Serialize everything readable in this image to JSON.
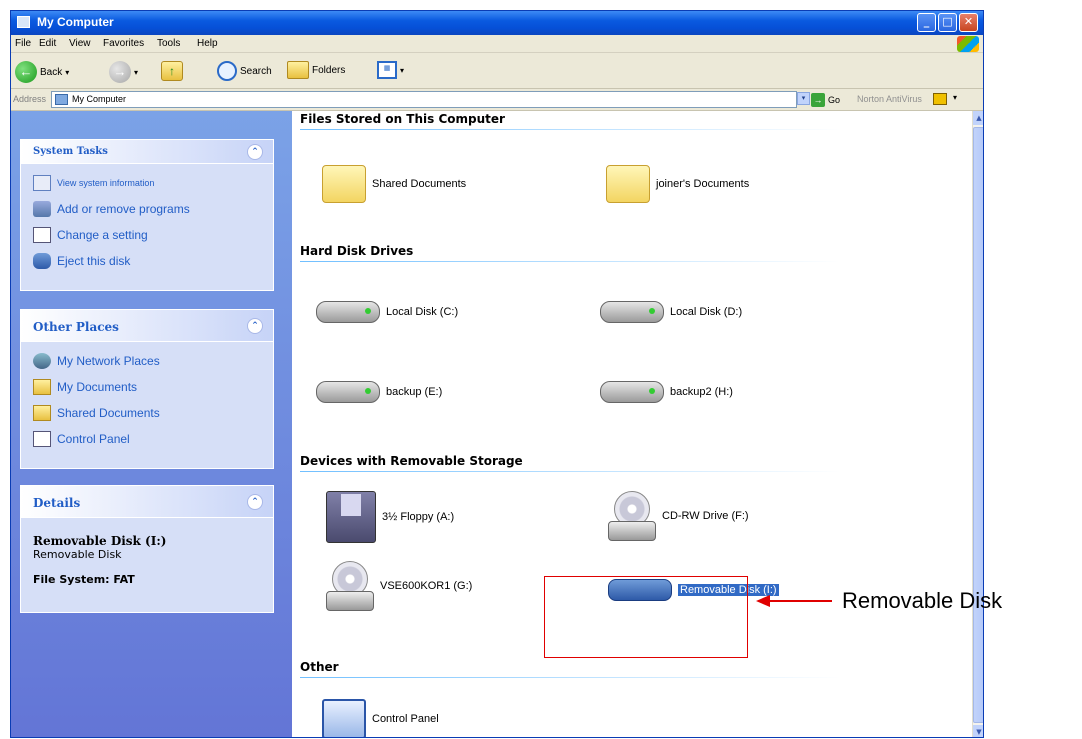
{
  "window": {
    "title": "My Computer",
    "controls": {
      "minimize": "_",
      "maximize": "□",
      "close": "✕"
    }
  },
  "menubar": [
    "File",
    "Edit",
    "View",
    "Favorites",
    "Tools",
    "Help"
  ],
  "toolbar": {
    "back_label": "Back",
    "search_label": "Search",
    "folders_label": "Folders"
  },
  "addressbar": {
    "label": "Address",
    "value": "My Computer",
    "go_label": "Go",
    "norton_label": "Norton AntiVirus"
  },
  "taskpane": {
    "system_tasks": {
      "title": "System Tasks",
      "items": [
        "View system information",
        "Add or remove programs",
        "Change a setting",
        "Eject this disk"
      ]
    },
    "other_places": {
      "title": "Other Places",
      "items": [
        "My Network Places",
        "My Documents",
        "Shared Documents",
        "Control Panel"
      ]
    },
    "details": {
      "title": "Details",
      "name": "Removable Disk (I:)",
      "type": "Removable Disk",
      "file_system": "File System: FAT"
    }
  },
  "groups": {
    "stored": {
      "title": "Files Stored on This Computer",
      "items": [
        "Shared Documents",
        "joiner's Documents"
      ]
    },
    "hard_disks": {
      "title": "Hard Disk Drives",
      "items": [
        "Local Disk (C:)",
        "Local Disk (D:)",
        "backup (E:)",
        "backup2 (H:)"
      ]
    },
    "removable": {
      "title": "Devices with Removable Storage",
      "items": [
        "3½ Floppy (A:)",
        "CD-RW Drive (F:)",
        "VSE600KOR1 (G:)",
        "Removable Disk (I:)"
      ]
    },
    "other": {
      "title": "Other",
      "items": [
        "Control Panel"
      ]
    }
  },
  "annotation": {
    "callout_text": "Removable Disk",
    "color": "#e00000"
  },
  "colors": {
    "title_bar": "#0a5ae0",
    "task_pane": "#6f8fe0",
    "panel_title": "#215dc6",
    "selection": "#316ac5"
  }
}
